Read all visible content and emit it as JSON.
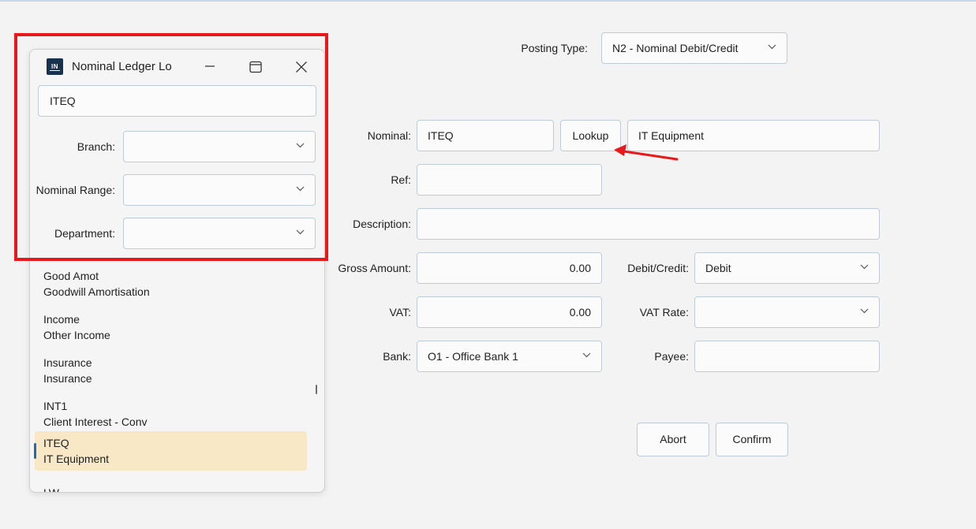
{
  "form": {
    "posting_type_label": "Posting Type:",
    "posting_type_value": "N2 - Nominal Debit/Credit",
    "nominal_label": "Nominal:",
    "nominal_value": "ITEQ",
    "lookup_label": "Lookup",
    "nominal_name_value": "IT Equipment",
    "ref_label": "Ref:",
    "ref_value": "",
    "description_label": "Description:",
    "description_value": "",
    "gross_amount_label": "Gross Amount:",
    "gross_amount_value": "0.00",
    "debit_credit_label": "Debit/Credit:",
    "debit_credit_value": "Debit",
    "vat_label": "VAT:",
    "vat_value": "0.00",
    "vat_rate_label": "VAT Rate:",
    "vat_rate_value": "",
    "bank_label": "Bank:",
    "bank_value": "O1 - Office Bank 1",
    "payee_label": "Payee:",
    "payee_value": "",
    "abort_label": "Abort",
    "confirm_label": "Confirm"
  },
  "dialog": {
    "app_icon_text": "IN",
    "title": "Nominal Ledger Lo",
    "search_value": "ITEQ",
    "branch_label": "Branch:",
    "branch_value": "",
    "nominal_range_label": "Nominal Range:",
    "nominal_range_value": "",
    "department_label": "Department:",
    "department_value": "",
    "items": [
      {
        "code": "Good Amot",
        "name": "Goodwill Amortisation",
        "selected": false
      },
      {
        "code": "Income",
        "name": "Other Income",
        "selected": false
      },
      {
        "code": "Insurance",
        "name": "Insurance",
        "selected": false
      },
      {
        "code": "INT1",
        "name": "Client Interest - Conv",
        "selected": false
      },
      {
        "code": "ITEQ",
        "name": "IT Equipment",
        "selected": true
      },
      {
        "code": "LW",
        "name": "",
        "selected": false
      }
    ]
  },
  "icons": {
    "app": "app-logo-icon",
    "minimize": "minimize-icon",
    "maximize": "maximize-icon",
    "close": "close-icon",
    "dropdown": "chevron-down-icon"
  },
  "colors": {
    "highlight_box": "#e8191a",
    "annotation_arrow": "#e8191a",
    "selected_row": "#f8e8c5",
    "selection_marker": "#1f6bb0",
    "field_border": "#bfcbd9",
    "app_icon_bg": "#17324f"
  }
}
